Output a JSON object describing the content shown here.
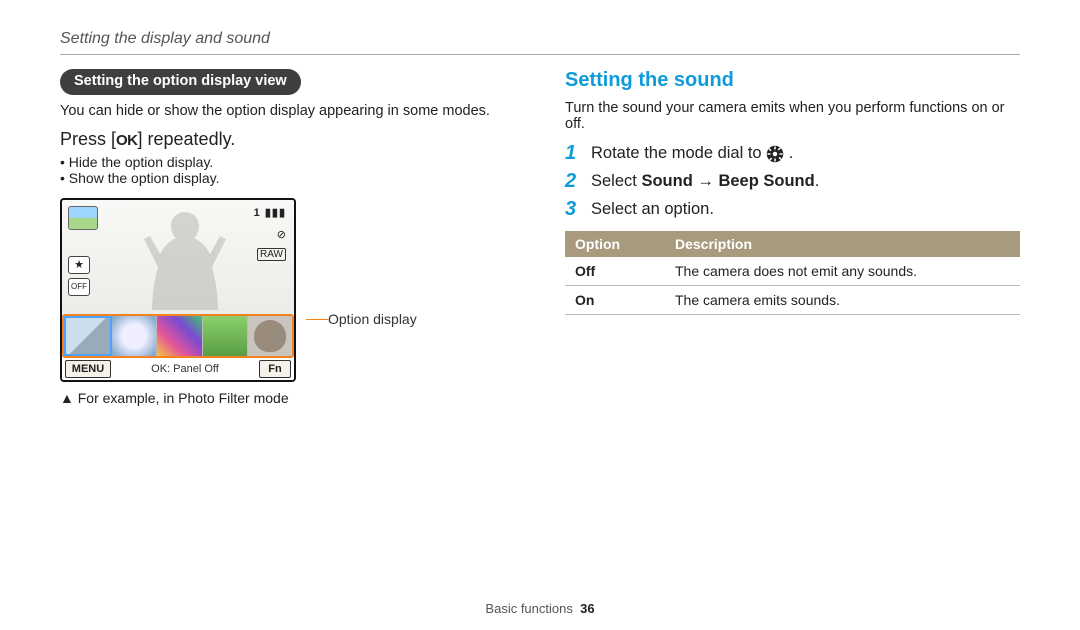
{
  "header": {
    "section_title": "Setting the display and sound"
  },
  "left": {
    "pill": "Setting the option display view",
    "intro": "You can hide or show the option display appearing in some modes.",
    "press_pre": "Press [",
    "press_key": "OK",
    "press_post": "] repeatedly.",
    "bullets": [
      "Hide the option display.",
      "Show the option display."
    ],
    "lcd": {
      "counter_text": "1",
      "side_icon_1": "★",
      "side_icon_2": "OFF",
      "flash_icon": "⊘",
      "raw_icon": "RAW",
      "menu_label": "MENU",
      "mid_label": "OK: Panel Off",
      "fn_label": "Fn"
    },
    "pointer_label": "Option display",
    "caption": "▲ For example, in Photo Filter mode"
  },
  "right": {
    "heading": "Setting the sound",
    "intro": "Turn the sound your camera emits when you perform functions on or off.",
    "steps": {
      "s1_pre": "Rotate the mode dial to ",
      "s1_post": ".",
      "s2_pre": "Select ",
      "s2_bold1": "Sound",
      "s2_arrow": " → ",
      "s2_bold2": "Beep Sound",
      "s2_post": ".",
      "s3": "Select an option."
    },
    "table": {
      "head_option": "Option",
      "head_desc": "Description",
      "rows": [
        {
          "opt": "Off",
          "desc": "The camera does not emit any sounds."
        },
        {
          "opt": "On",
          "desc": "The camera emits sounds."
        }
      ]
    }
  },
  "footer": {
    "chapter": "Basic functions",
    "page": "36"
  }
}
